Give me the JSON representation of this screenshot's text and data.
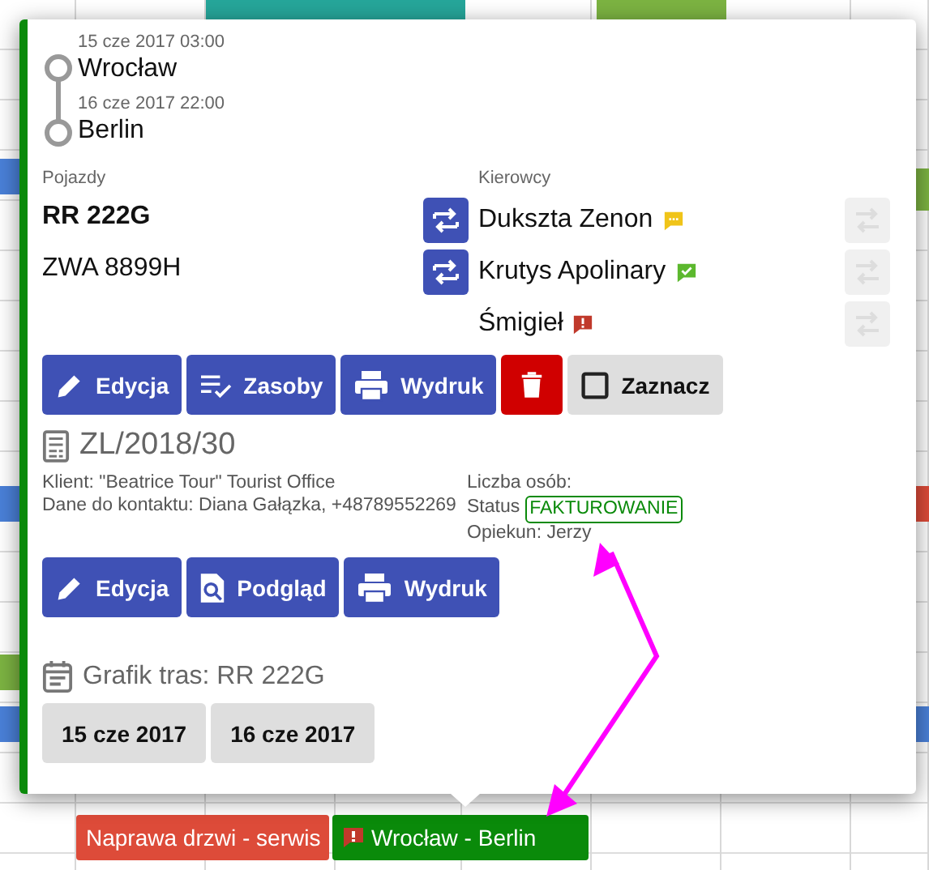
{
  "calendar": {
    "events": [
      {
        "label": "Naprawa drzwi - serwis",
        "color": "#dd4b39",
        "alert": false
      },
      {
        "label": "Wrocław - Berlin",
        "color": "#0a8a0a",
        "alert": true
      }
    ]
  },
  "popup": {
    "route": {
      "stops": [
        {
          "time": "15 cze 2017 03:00",
          "city": "Wrocław"
        },
        {
          "time": "16 cze 2017 22:00",
          "city": "Berlin"
        }
      ]
    },
    "vehicles": {
      "label": "Pojazdy",
      "items": [
        {
          "plate": "RR 222G",
          "main": true
        },
        {
          "plate": "ZWA 8899H",
          "main": false
        }
      ]
    },
    "drivers": {
      "label": "Kierowcy",
      "items": [
        {
          "name": "Dukszta Zenon",
          "kind": "comment",
          "swap": true,
          "reassign_disabled": true
        },
        {
          "name": "Krutys Apolinary",
          "kind": "confirmed",
          "swap": true,
          "reassign_disabled": true
        },
        {
          "name": "Śmigieł",
          "kind": "warning",
          "swap": false,
          "reassign_disabled": true
        }
      ]
    },
    "actions": [
      {
        "kind": "edit",
        "label": "Edycja"
      },
      {
        "kind": "resources",
        "label": "Zasoby"
      },
      {
        "kind": "print",
        "label": "Wydruk"
      },
      {
        "kind": "delete"
      },
      {
        "kind": "select",
        "label": "Zaznacz",
        "checked": false
      }
    ],
    "order": {
      "number": "ZL/2018/30",
      "client": "Klient: \"Beatrice Tour\" Tourist Office",
      "contact": "Dane do kontaktu: Diana Gałązka, +48789552269",
      "people": "Liczba osób:",
      "status_label": "Status",
      "status": "FAKTUROWANIE",
      "guardian": "Opiekun: Jerzy",
      "actions": [
        {
          "kind": "edit",
          "label": "Edycja"
        },
        {
          "kind": "preview",
          "label": "Podgląd"
        },
        {
          "kind": "print",
          "label": "Wydruk"
        }
      ]
    },
    "schedule": {
      "title": "Grafik tras: RR 222G",
      "days": [
        "15 cze 2017",
        "16 cze 2017"
      ]
    }
  }
}
